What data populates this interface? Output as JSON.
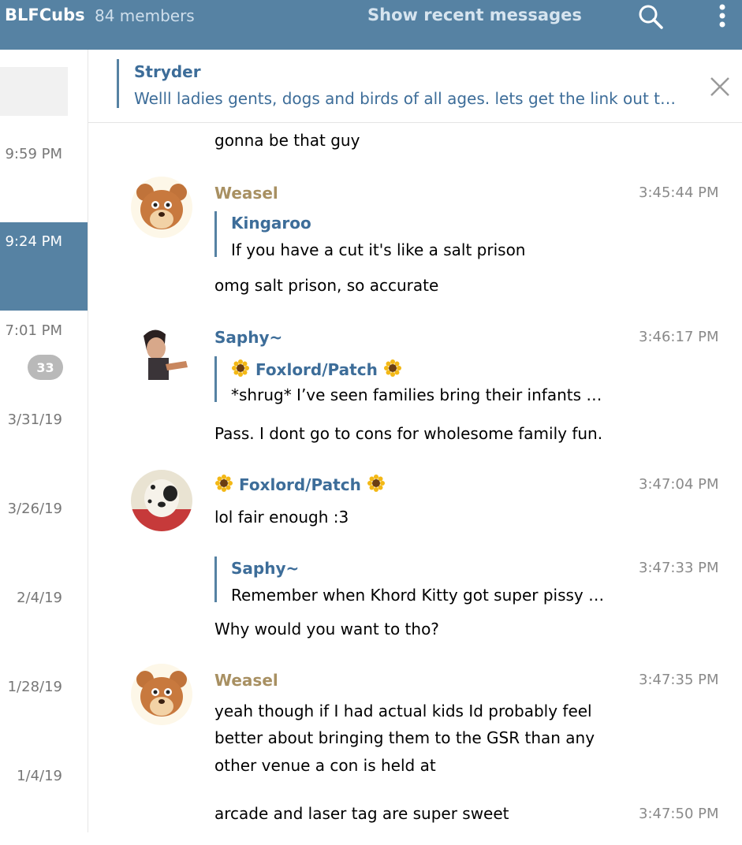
{
  "header": {
    "title": "BLFCubs",
    "members": "84 members",
    "recent_button": "Show recent messages",
    "icons": [
      "search-icon",
      "more-vertical-icon"
    ]
  },
  "sidebar": {
    "items": [
      {
        "time": "9:59 PM",
        "active": false
      },
      {
        "time": "9:24 PM",
        "active": true
      },
      {
        "time": "7:01 PM",
        "active": false,
        "badge": "33"
      },
      {
        "time": "3/31/19",
        "active": false
      },
      {
        "time": "3/26/19",
        "active": false
      },
      {
        "time": "2/4/19",
        "active": false
      },
      {
        "time": "1/28/19",
        "active": false
      },
      {
        "time": "1/4/19",
        "active": false
      }
    ]
  },
  "pinned": {
    "author": "Stryder",
    "text": "Welll ladies gents, dogs and birds of all ages. lets get the link out t…"
  },
  "messages": {
    "m0": {
      "text": "gonna be that guy"
    },
    "m1": {
      "author": "Weasel",
      "time": "3:45:44 PM",
      "reply_author": "Kingaroo",
      "reply_text": "If you have a cut it's like a salt prison",
      "text": "omg salt prison, so accurate"
    },
    "m2": {
      "author": "Saphy~",
      "time": "3:46:17 PM",
      "reply_author": "Foxlord/Patch",
      "reply_text": "*shrug* I’ve seen families bring their infants …",
      "text": "Pass. I dont go to cons for wholesome family fun."
    },
    "m3": {
      "author": "Foxlord/Patch",
      "time": "3:47:04 PM",
      "text": "lol fair enough :3"
    },
    "m4": {
      "time": "3:47:33 PM",
      "reply_author": "Saphy~",
      "reply_text": "Remember when Khord Kitty got super pissy …",
      "text": "Why would you want to tho?"
    },
    "m5": {
      "author": "Weasel",
      "time": "3:47:35 PM",
      "lines": [
        "yeah though if I had actual kids Id probably feel",
        "better about bringing them to the GSR than any",
        "other venue a con is held at"
      ]
    },
    "m6": {
      "time": "3:47:50 PM",
      "text": "arcade and laser tag are super sweet"
    }
  },
  "colors": {
    "header": "#5682a3",
    "link": "#3d6d99",
    "weasel": "#a89062",
    "badge": "#b9b9b9"
  }
}
